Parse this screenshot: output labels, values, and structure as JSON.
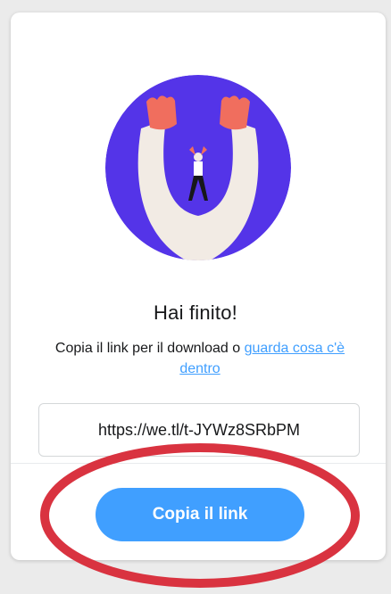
{
  "dialog": {
    "title": "Hai finito!",
    "subtitle_text": "Copia il link per il download o ",
    "subtitle_link": "guarda cosa c'è dentro",
    "link_value": "https://we.tl/t-JYWz8SRbPM",
    "copy_button_label": "Copia il link"
  },
  "colors": {
    "accent": "#409fff",
    "illustration_circle": "#5434e8",
    "annotation_ring": "#d93340"
  },
  "icons": {
    "illustration": "person-raising-arms-icon"
  }
}
